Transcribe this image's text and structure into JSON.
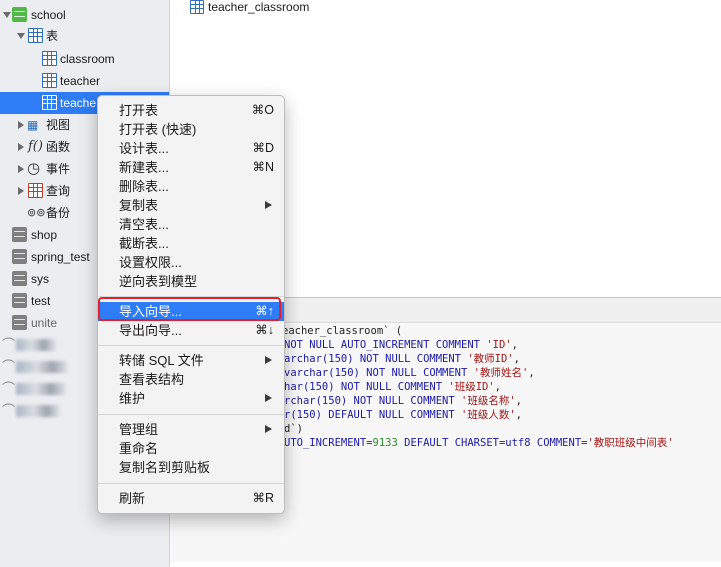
{
  "sidebar": {
    "db_school": "school",
    "folder_tables": "表",
    "tables": [
      "classroom",
      "teacher",
      "teache"
    ],
    "folder_views": "视图",
    "folder_functions": "函数",
    "folder_events": "事件",
    "folder_queries": "查询",
    "folder_backups": "备份",
    "databases": [
      "shop",
      "spring_test",
      "sys",
      "test",
      "unite"
    ]
  },
  "main": {
    "open_table": "teacher_classroom",
    "sql": {
      "line1": "eacher_classroom` (",
      "line2a": "NOT NULL AUTO_INCREMENT COMMENT ",
      "line2b": "'ID'",
      "line3a": "archar(150) NOT NULL COMMENT ",
      "line3b": "'教师ID'",
      "line4a": "varchar(150) NOT NULL COMMENT ",
      "line4b": "'教师姓名'",
      "line5a": "har(150) NOT NULL COMMENT ",
      "line5b": "'班级ID'",
      "line6a": "rchar(150) NOT NULL COMMENT ",
      "line6b": "'班级名称'",
      "line7a": "r(150) DEFAULT NULL COMMENT ",
      "line7b": "'班级人数'",
      "line8": "d`)",
      "line9a": "UTO_INCREMENT=",
      "line9num": "9133",
      "line9b": " DEFAULT CHARSET=utf8 COMMENT=",
      "line9c": "'教职班级中间表'"
    }
  },
  "menu": {
    "items": [
      {
        "label": "打开表",
        "shortcut": "⌘O"
      },
      {
        "label": "打开表 (快速)",
        "shortcut": ""
      },
      {
        "label": "设计表...",
        "shortcut": "⌘D"
      },
      {
        "label": "新建表...",
        "shortcut": "⌘N"
      },
      {
        "label": "删除表...",
        "shortcut": ""
      },
      {
        "label": "复制表",
        "shortcut": ""
      },
      {
        "label": "清空表...",
        "shortcut": ""
      },
      {
        "label": "截断表...",
        "shortcut": ""
      },
      {
        "label": "设置权限...",
        "shortcut": ""
      },
      {
        "label": "逆向表到模型",
        "shortcut": ""
      },
      {
        "label": "导入向导...",
        "shortcut": "⌘↑"
      },
      {
        "label": "导出向导...",
        "shortcut": "⌘↓"
      },
      {
        "label": "转储 SQL 文件",
        "shortcut": ""
      },
      {
        "label": "查看表结构",
        "shortcut": ""
      },
      {
        "label": "维护",
        "shortcut": ""
      },
      {
        "label": "管理组",
        "shortcut": ""
      },
      {
        "label": "重命名",
        "shortcut": ""
      },
      {
        "label": "复制名到剪贴板",
        "shortcut": ""
      },
      {
        "label": "刷新",
        "shortcut": "⌘R"
      }
    ]
  },
  "colors": {
    "selection": "#2e7cf6",
    "highlight_box": "#e0202c",
    "db_active": "#52b847"
  }
}
